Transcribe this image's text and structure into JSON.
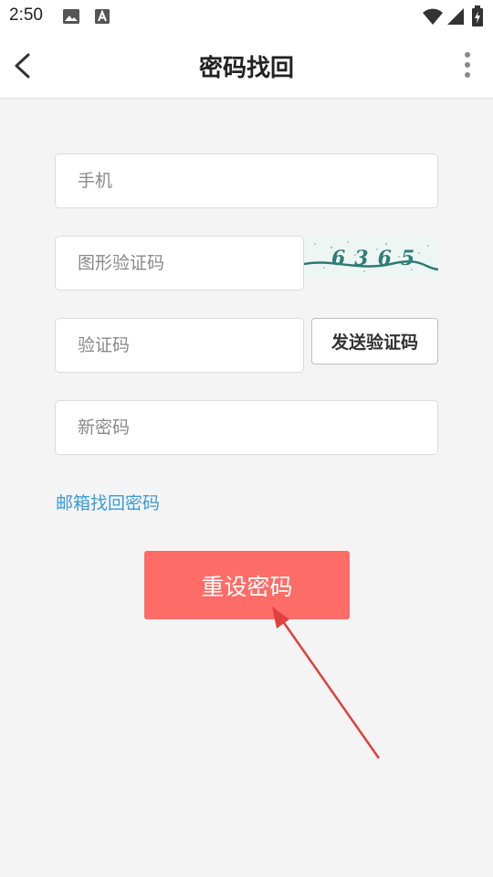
{
  "status_bar": {
    "time": "2:50",
    "icons": [
      "image-icon",
      "text-a-icon",
      "wifi-icon",
      "signal-icon",
      "battery-icon"
    ]
  },
  "header": {
    "title": "密码找回",
    "back_icon": "chevron-left-icon",
    "menu_icon": "more-vertical-icon"
  },
  "form": {
    "phone_placeholder": "手机",
    "captcha_placeholder": "图形验证码",
    "captcha_text": "6365",
    "sms_code_placeholder": "验证码",
    "send_code_label": "发送验证码",
    "new_password_placeholder": "新密码"
  },
  "email_recovery_link": "邮箱找回密码",
  "reset_button_label": "重设密码",
  "colors": {
    "primary_button": "#fd6c66",
    "link": "#3c9ad6",
    "background": "#f4f4f4",
    "annotation_arrow": "#e04040"
  }
}
